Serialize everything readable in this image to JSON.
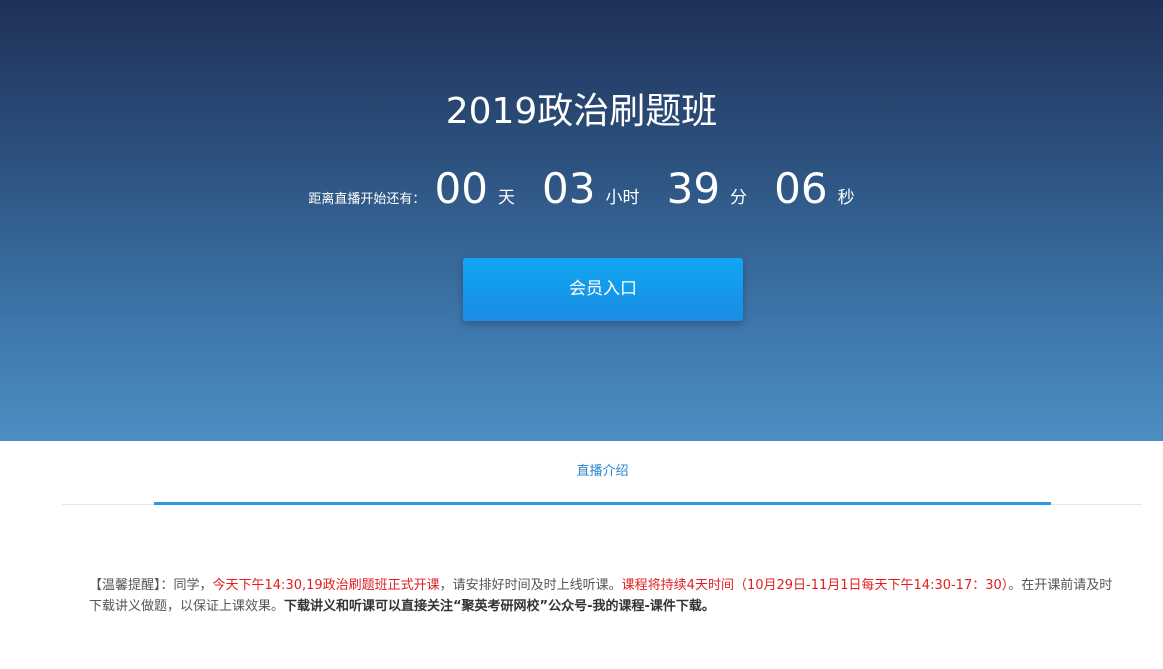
{
  "hero": {
    "title": "2019政治刷题班",
    "countdown_label": "距离直播开始还有：",
    "countdown": [
      {
        "value": "00",
        "unit": "天"
      },
      {
        "value": "03",
        "unit": "小时"
      },
      {
        "value": "39",
        "unit": "分"
      },
      {
        "value": "06",
        "unit": "秒"
      }
    ],
    "member_button": "会员入口"
  },
  "tabs": {
    "active_label": "直播介绍"
  },
  "notice": {
    "part1": "【温馨提醒】：同学，",
    "part2_red": "今天下午14:30,19政治刷题班正式开课",
    "part3": "，请安排好时间及时上线听课。",
    "part4_red": "课程将持续4天时间（10月29日-11月1日每天下午14:30-17：30）",
    "part5": "。在开课前请及时下载讲义做题，以保证上课效果。",
    "part6_bold": "下载讲义和听课可以直接关注“聚英考研网校”公众号-我的课程-课件下载。"
  },
  "colors": {
    "hero_top": "#1f3157",
    "hero_bottom": "#4b8ec3",
    "button": "#1a8ce4",
    "tab_accent": "#2b97e0",
    "highlight_red": "#e02020"
  }
}
